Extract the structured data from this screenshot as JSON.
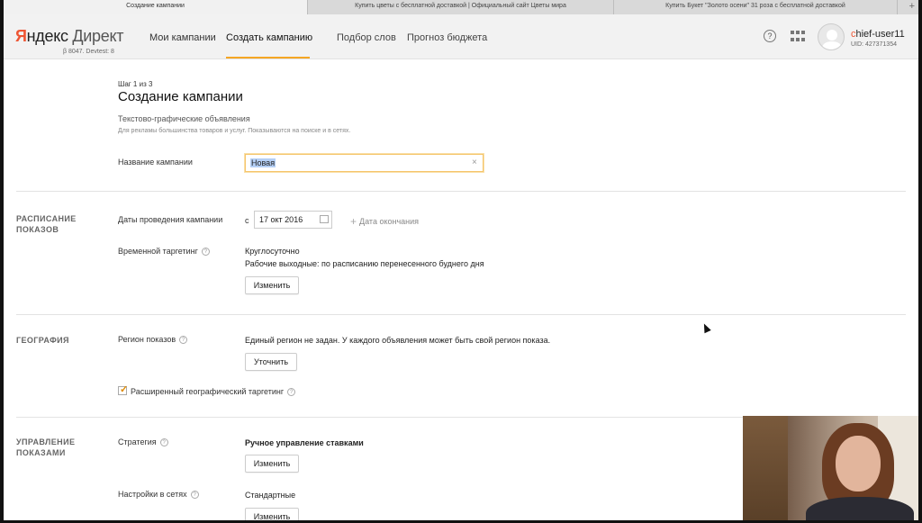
{
  "browser": {
    "tabs": [
      "Создание кампании",
      "Купить цветы с бесплатной доставкой | Официальный сайт Цветы мира",
      "Купить Букет \"Золото осени\" 31 роза с бесплатной доставкой"
    ],
    "new_tab": "+"
  },
  "header": {
    "logo_ya": "Я",
    "logo_ndex": "ндекс",
    "logo_direct": "Директ",
    "build": "β 8047. Devtest: 8",
    "nav": [
      "Мои кампании",
      "Создать кампанию",
      "Подбор слов",
      "Прогноз бюджета"
    ],
    "active_nav": "Создать кампанию",
    "help": "?",
    "user": {
      "first_letter": "c",
      "rest": "hief-user11",
      "uid": "UID: 427371354"
    }
  },
  "page": {
    "step": "Шаг 1 из 3",
    "title": "Создание кампании",
    "type_title": "Текстово-графические объявления",
    "type_desc": "Для рекламы большинства товаров и услуг. Показываются на поиске и в сетях.",
    "name_label": "Название кампании",
    "name_value": "Новая",
    "clear": "×"
  },
  "schedule": {
    "section": [
      "РАСПИСАНИЕ",
      "ПОКАЗОВ"
    ],
    "dates_label": "Даты проведения кампании",
    "date_prefix": "с",
    "start_date": "17 окт 2016",
    "end_date_link": "Дата окончания",
    "targeting_label": "Временной таргетинг",
    "targeting_value": "Круглосуточно",
    "holidays_value": "Рабочие выходные: по расписанию перенесенного буднего дня",
    "change_button": "Изменить"
  },
  "geo": {
    "section": "ГЕОГРАФИЯ",
    "region_label": "Регион показов",
    "region_value": "Единый регион не задан. У каждого объявления может быть свой регион показа.",
    "refine_button": "Уточнить",
    "extended_label": "Расширенный географический таргетинг",
    "extended_checked": true
  },
  "management": {
    "section": [
      "УПРАВЛЕНИЕ",
      "ПОКАЗАМИ"
    ],
    "strategy_label": "Стратегия",
    "strategy_value": "Ручное управление ставками",
    "strategy_button": "Изменить",
    "network_label": "Настройки в сетях",
    "network_value": "Стандартные",
    "network_button": "Изменить"
  },
  "colors": {
    "accent": "#f5a623",
    "brand_red": "#e53333",
    "selection": "#b4cff5"
  }
}
